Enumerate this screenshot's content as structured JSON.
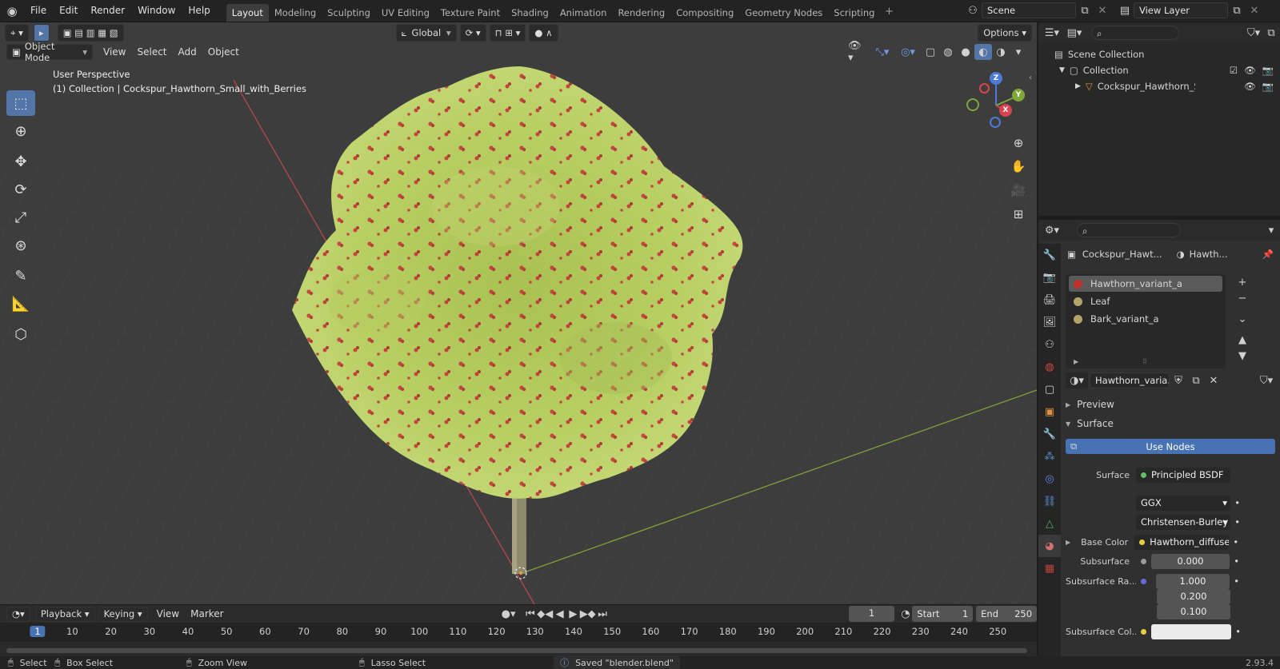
{
  "app": {
    "version": "2.93.4"
  },
  "topbar": {
    "menus": [
      "File",
      "Edit",
      "Render",
      "Window",
      "Help"
    ],
    "workspaces": [
      "Layout",
      "Modeling",
      "Sculpting",
      "UV Editing",
      "Texture Paint",
      "Shading",
      "Animation",
      "Rendering",
      "Compositing",
      "Geometry Nodes",
      "Scripting"
    ],
    "active_workspace": "Layout",
    "scene": "Scene",
    "view_layer": "View Layer"
  },
  "viewport": {
    "mode": "Object Mode",
    "menus": [
      "View",
      "Select",
      "Add",
      "Object"
    ],
    "transform_orientation": "Global",
    "options_label": "Options",
    "overlay_title": "User Perspective",
    "overlay_subtitle": "(1) Collection | Cockspur_Hawthorn_Small_with_Berries",
    "gizmo": {
      "x": "X",
      "y": "Y",
      "z": "Z"
    }
  },
  "outliner": {
    "scene_collection": "Scene Collection",
    "collection": "Collection",
    "object": "Cockspur_Hawthorn_Sma"
  },
  "properties": {
    "breadcrumb_object": "Cockspur_Hawt...",
    "breadcrumb_material": "Hawth...",
    "material_slots": [
      {
        "name": "Hawthorn_variant_a",
        "color": "#c0302a",
        "selected": true
      },
      {
        "name": "Leaf",
        "color": "#b5a36a",
        "selected": false
      },
      {
        "name": "Bark_variant_a",
        "color": "#b5a36a",
        "selected": false
      }
    ],
    "material_name": "Hawthorn_varia...",
    "preview_label": "Preview",
    "surface_label": "Surface",
    "use_nodes_label": "Use Nodes",
    "surface": {
      "label": "Surface",
      "value": "Principled BSDF"
    },
    "distribution": "GGX",
    "subsurface_method": "Christensen-Burley",
    "base_color": {
      "label": "Base Color",
      "value": "Hawthorn_diffuse...."
    },
    "subsurface": {
      "label": "Subsurface",
      "value": "0.000"
    },
    "subsurface_radius": {
      "label": "Subsurface Ra...",
      "values": [
        "1.000",
        "0.200",
        "0.100"
      ]
    },
    "subsurface_color": {
      "label": "Subsurface Col..."
    }
  },
  "timeline": {
    "menus": [
      "Playback",
      "Keying",
      "View",
      "Marker"
    ],
    "current_frame": "1",
    "start_label": "Start",
    "start": "1",
    "end_label": "End",
    "end": "250",
    "ruler": [
      "1",
      "10",
      "20",
      "30",
      "40",
      "50",
      "60",
      "70",
      "80",
      "90",
      "100",
      "110",
      "120",
      "130",
      "140",
      "150",
      "160",
      "170",
      "180",
      "190",
      "200",
      "210",
      "220",
      "230",
      "240",
      "250"
    ]
  },
  "statusbar": {
    "select": "Select",
    "box_select": "Box Select",
    "zoom_view": "Zoom View",
    "lasso_select": "Lasso Select",
    "message": "Saved \"blender.blend\""
  }
}
